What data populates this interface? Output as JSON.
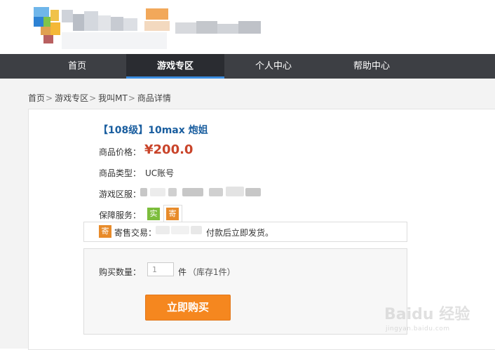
{
  "nav": {
    "items": [
      {
        "label": "首页"
      },
      {
        "label": "游戏专区"
      },
      {
        "label": "个人中心"
      },
      {
        "label": "帮助中心"
      }
    ],
    "active_index": 1
  },
  "breadcrumb": {
    "items": [
      "首页",
      "游戏专区",
      "我叫MT",
      "商品详情"
    ],
    "separator": ">"
  },
  "product": {
    "title": "【108级】10max 炮姐",
    "price_label": "商品价格：",
    "price": "¥200.0",
    "type_label": "商品类型：",
    "type_value": "UC账号",
    "server_label": "游戏区服：",
    "service_label": "保障服务：",
    "service_badges": [
      "实",
      "寄"
    ],
    "consign_badge": "寄",
    "consign_label": "寄售交易：",
    "consign_suffix": "付款后立即发货。"
  },
  "purchase": {
    "qty_label": "购买数量：",
    "qty_value": "1",
    "unit": "件",
    "stock": "（库存1件）",
    "buy_button": "立即购买"
  },
  "watermark": {
    "brand": "Baidu 经验",
    "url": "jingyan.baidu.com"
  },
  "colors": {
    "nav_bg": "#3d3f44",
    "nav_active_underline": "#3b8de0",
    "title": "#1a5e9f",
    "price": "#c9442a",
    "buy_button": "#f5871f",
    "badge_real": "#7cbd3c",
    "badge_consign": "#e88b2a"
  }
}
